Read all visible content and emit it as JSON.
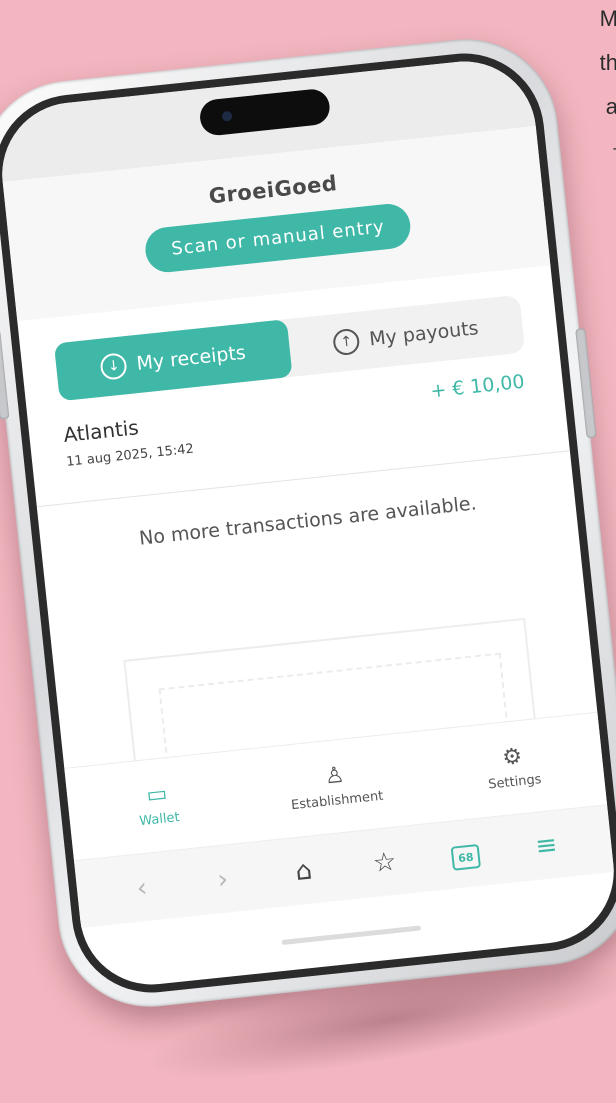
{
  "background_text": {
    "line1": "M",
    "line2": "th",
    "line3": "a",
    "line4": "-"
  },
  "app": {
    "title": "GroeiGoed",
    "scan_button": "Scan or manual entry"
  },
  "tabs": [
    {
      "label": "My receipts",
      "icon": "arrow-down-circle-icon",
      "active": true
    },
    {
      "label": "My payouts",
      "icon": "arrow-up-circle-icon",
      "active": false
    }
  ],
  "transactions": [
    {
      "name": "Atlantis",
      "amount": "+ € 10,00",
      "date": "11 aug 2025, 15:42"
    }
  ],
  "empty_message": "No more transactions are available.",
  "bottom_nav": [
    {
      "label": "Wallet",
      "icon": "wallet-icon",
      "active": true
    },
    {
      "label": "Establishment",
      "icon": "person-icon",
      "active": false
    },
    {
      "label": "Settings",
      "icon": "gear-icon",
      "active": false
    }
  ],
  "browser_bar": {
    "tab_count": "68"
  },
  "colors": {
    "accent": "#3fb8a7",
    "background": "#f3b6c0"
  }
}
